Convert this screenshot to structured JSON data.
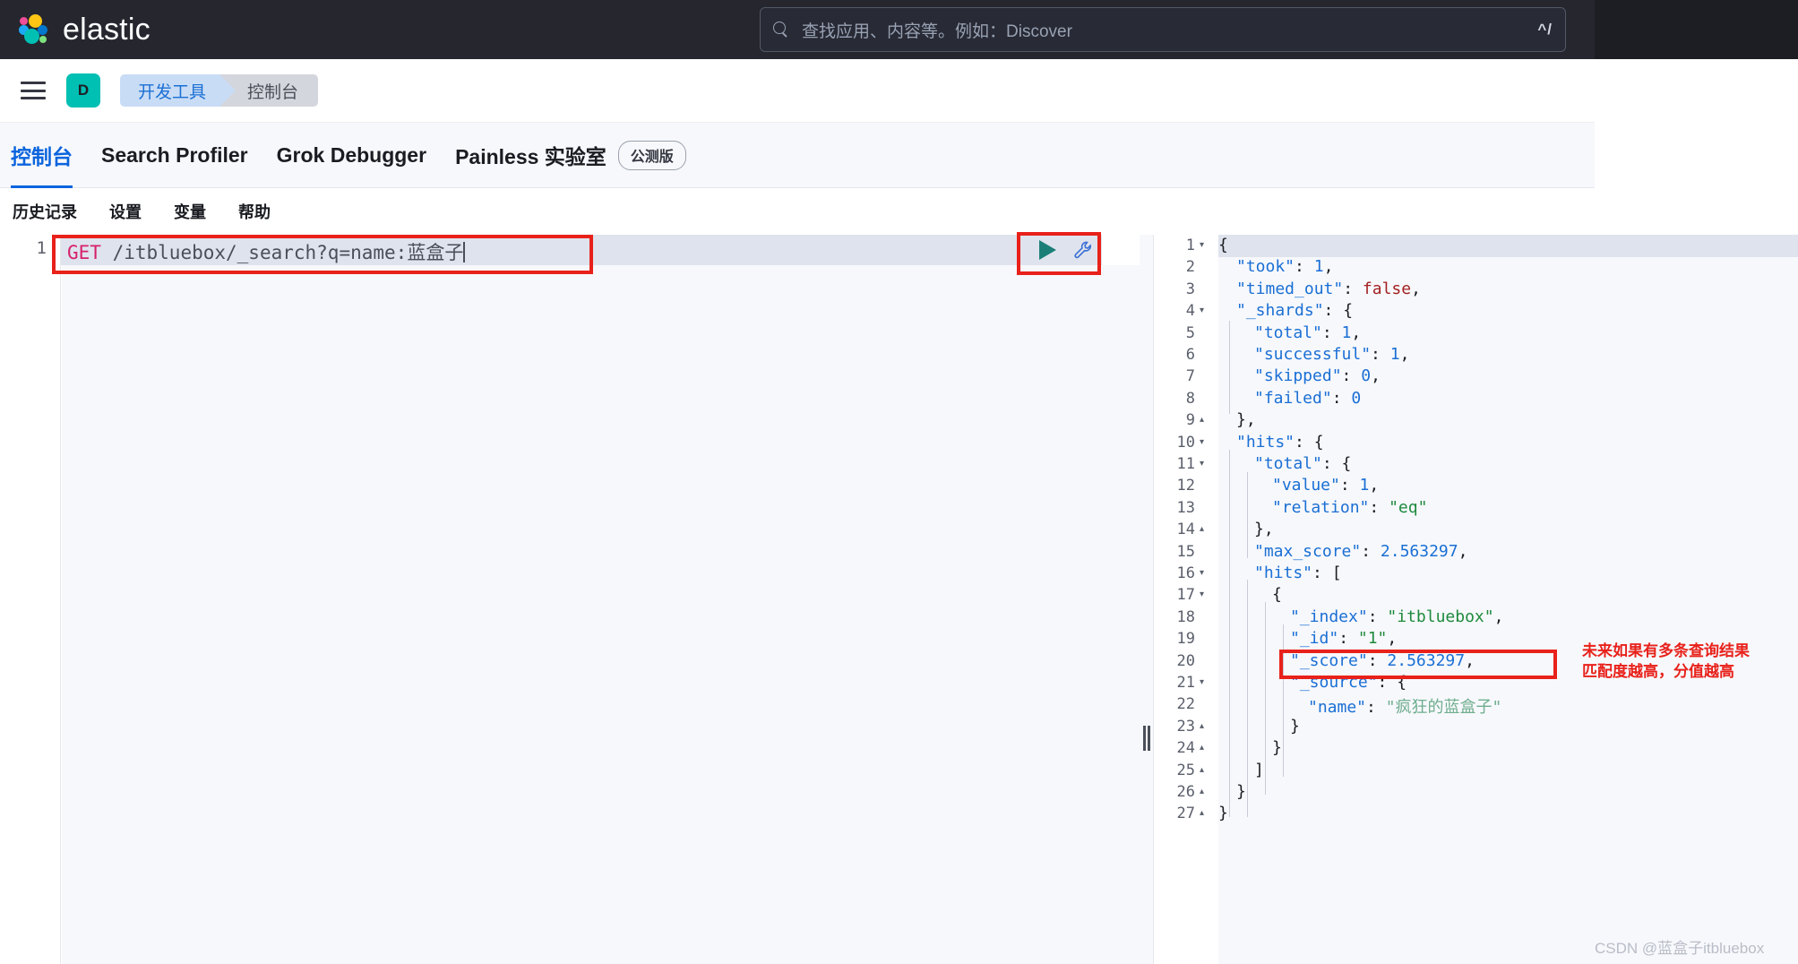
{
  "topbar": {
    "brand": "elastic",
    "logo_icon": "elastic-logo-icon",
    "search": {
      "placeholder": "查找应用、内容等。例如：Discover",
      "icon": "search-icon",
      "shortcut": "^/"
    }
  },
  "breadcrumb": {
    "menu_icon": "hamburger-menu-icon",
    "space_initial": "D",
    "items": [
      {
        "label": "开发工具"
      },
      {
        "label": "控制台"
      }
    ]
  },
  "tabs": [
    {
      "label": "控制台",
      "active": true
    },
    {
      "label": "Search Profiler",
      "active": false
    },
    {
      "label": "Grok Debugger",
      "active": false
    },
    {
      "label": "Painless 实验室",
      "active": false,
      "badge": "公测版"
    }
  ],
  "submenu": [
    {
      "label": "历史记录"
    },
    {
      "label": "设置"
    },
    {
      "label": "变量"
    },
    {
      "label": "帮助"
    }
  ],
  "request_editor": {
    "line_number": "1",
    "method": "GET",
    "path": "/itbluebox/_search?q=name:",
    "query_term": "蓝盒子",
    "run_icon": "play-triangle-icon",
    "wrench_icon": "wrench-icon"
  },
  "response_editor": {
    "lines": [
      {
        "n": "1",
        "fold": "▾",
        "indent": 0,
        "code": "{"
      },
      {
        "n": "2",
        "fold": "",
        "indent": 1,
        "code": "\"took\": 1,"
      },
      {
        "n": "3",
        "fold": "",
        "indent": 1,
        "code": "\"timed_out\": false,"
      },
      {
        "n": "4",
        "fold": "▾",
        "indent": 1,
        "code": "\"_shards\": {"
      },
      {
        "n": "5",
        "fold": "",
        "indent": 2,
        "code": "\"total\": 1,"
      },
      {
        "n": "6",
        "fold": "",
        "indent": 2,
        "code": "\"successful\": 1,"
      },
      {
        "n": "7",
        "fold": "",
        "indent": 2,
        "code": "\"skipped\": 0,"
      },
      {
        "n": "8",
        "fold": "",
        "indent": 2,
        "code": "\"failed\": 0"
      },
      {
        "n": "9",
        "fold": "▴",
        "indent": 1,
        "code": "},"
      },
      {
        "n": "10",
        "fold": "▾",
        "indent": 1,
        "code": "\"hits\": {"
      },
      {
        "n": "11",
        "fold": "▾",
        "indent": 2,
        "code": "\"total\": {"
      },
      {
        "n": "12",
        "fold": "",
        "indent": 3,
        "code": "\"value\": 1,"
      },
      {
        "n": "13",
        "fold": "",
        "indent": 3,
        "code": "\"relation\": \"eq\""
      },
      {
        "n": "14",
        "fold": "▴",
        "indent": 2,
        "code": "},"
      },
      {
        "n": "15",
        "fold": "",
        "indent": 2,
        "code": "\"max_score\": 2.563297,"
      },
      {
        "n": "16",
        "fold": "▾",
        "indent": 2,
        "code": "\"hits\": ["
      },
      {
        "n": "17",
        "fold": "▾",
        "indent": 3,
        "code": "{"
      },
      {
        "n": "18",
        "fold": "",
        "indent": 4,
        "code": "\"_index\": \"itbluebox\","
      },
      {
        "n": "19",
        "fold": "",
        "indent": 4,
        "code": "\"_id\": \"1\","
      },
      {
        "n": "20",
        "fold": "",
        "indent": 4,
        "code": "\"_score\": 2.563297,"
      },
      {
        "n": "21",
        "fold": "▾",
        "indent": 4,
        "code": "\"_source\": {"
      },
      {
        "n": "22",
        "fold": "",
        "indent": 5,
        "code": "\"name\": \"疯狂的蓝盒子\""
      },
      {
        "n": "23",
        "fold": "▴",
        "indent": 4,
        "code": "}"
      },
      {
        "n": "24",
        "fold": "▴",
        "indent": 3,
        "code": "}"
      },
      {
        "n": "25",
        "fold": "▴",
        "indent": 2,
        "code": "]"
      },
      {
        "n": "26",
        "fold": "▴",
        "indent": 1,
        "code": "}"
      },
      {
        "n": "27",
        "fold": "▴",
        "indent": 0,
        "code": "}"
      }
    ]
  },
  "annotations": {
    "score_note_line1": "未来如果有多条查询结果",
    "score_note_line2": "匹配度越高，分值越高",
    "highlight_color": "#e8211a"
  },
  "watermark": "CSDN @蓝盒子itbluebox",
  "colors": {
    "topbar_bg": "#25262e",
    "accent_blue": "#0b64dd",
    "space_teal": "#00bfb3",
    "run_teal": "#1b7f78"
  }
}
